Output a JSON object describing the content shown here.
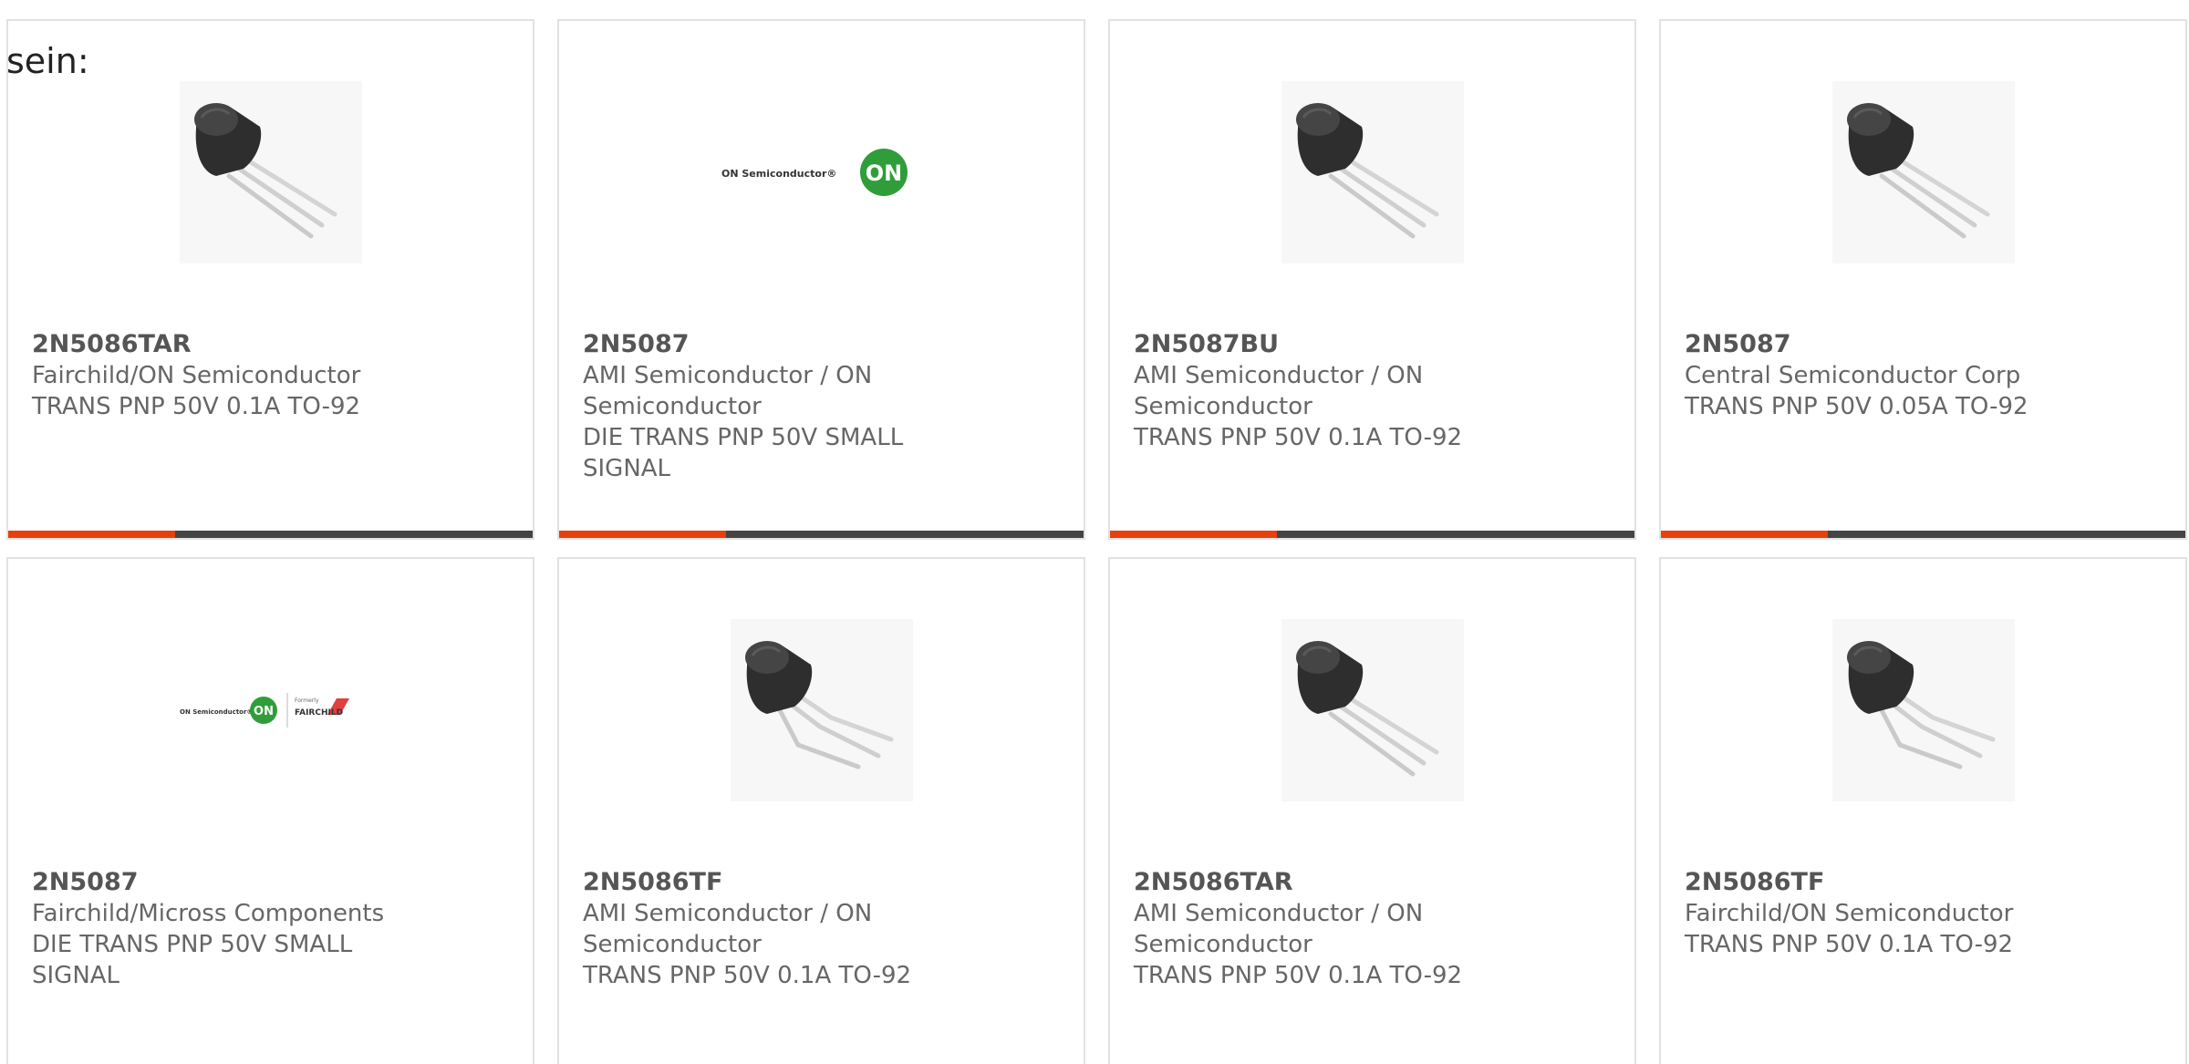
{
  "intro_text": "sein:",
  "colors": {
    "accent": "#e8400c",
    "bar_dark": "#444444",
    "on_green": "#2f9e3a"
  },
  "cards": [
    {
      "image": "to92-transistor-straight-leads",
      "part": "2N5086TAR",
      "mfr_lines": [
        "Fairchild/ON Semiconductor"
      ],
      "desc_lines": [
        "TRANS PNP 50V 0.1A TO-92"
      ]
    },
    {
      "image": "on-semiconductor-logo",
      "logo_text": "ON Semiconductor®",
      "logo_badge": "ON",
      "part": "2N5087",
      "mfr_lines": [
        "AMI Semiconductor / ON",
        "Semiconductor"
      ],
      "desc_lines": [
        "DIE TRANS PNP 50V SMALL",
        "SIGNAL"
      ]
    },
    {
      "image": "to92-transistor-straight-leads",
      "part": "2N5087BU",
      "mfr_lines": [
        "AMI Semiconductor / ON",
        "Semiconductor"
      ],
      "desc_lines": [
        "TRANS PNP 50V 0.1A TO-92"
      ]
    },
    {
      "image": "to92-transistor-straight-leads",
      "part": "2N5087",
      "mfr_lines": [
        "Central Semiconductor Corp"
      ],
      "desc_lines": [
        "TRANS PNP 50V 0.05A TO-92"
      ]
    },
    {
      "image": "on-fairchild-logo",
      "logo_text": "ON Semiconductor®",
      "logo_badge": "ON",
      "logo_formerly": "Formerly",
      "logo_fairchild": "FAIRCHILD",
      "part": "2N5087",
      "mfr_lines": [
        "Fairchild/Micross Components"
      ],
      "desc_lines": [
        "DIE TRANS PNP 50V SMALL",
        "SIGNAL"
      ]
    },
    {
      "image": "to92-transistor-bent-leads",
      "part": "2N5086TF",
      "mfr_lines": [
        "AMI Semiconductor / ON",
        "Semiconductor"
      ],
      "desc_lines": [
        "TRANS PNP 50V 0.1A TO-92"
      ]
    },
    {
      "image": "to92-transistor-straight-leads",
      "part": "2N5086TAR",
      "mfr_lines": [
        "AMI Semiconductor / ON",
        "Semiconductor"
      ],
      "desc_lines": [
        "TRANS PNP 50V 0.1A TO-92"
      ]
    },
    {
      "image": "to92-transistor-bent-leads",
      "part": "2N5086TF",
      "mfr_lines": [
        "Fairchild/ON Semiconductor"
      ],
      "desc_lines": [
        "TRANS PNP 50V 0.1A TO-92"
      ]
    }
  ]
}
